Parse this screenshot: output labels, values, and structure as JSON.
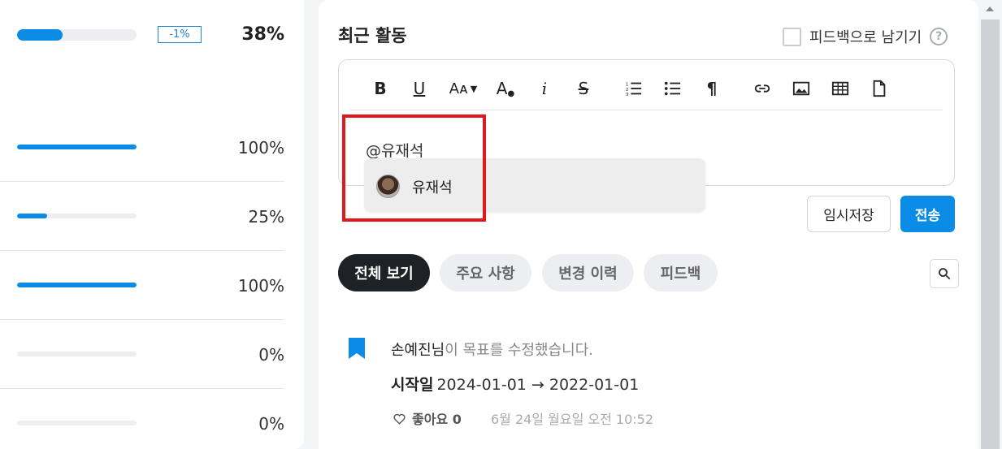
{
  "progress_list": [
    {
      "percent_text": "38%",
      "value": 0.38,
      "delta": "-1%"
    },
    {
      "percent_text": "100%",
      "value": 1.0
    },
    {
      "percent_text": "25%",
      "value": 0.25
    },
    {
      "percent_text": "100%",
      "value": 1.0
    },
    {
      "percent_text": "0%",
      "value": 0.0
    },
    {
      "percent_text": "0%",
      "value": 0.0
    }
  ],
  "activity": {
    "title": "최근 활동",
    "feedback_checkbox_label": "피드백으로 남기기",
    "help_label": "?"
  },
  "editor": {
    "toolbar": [
      {
        "label": "B",
        "icon": "bold-icon"
      },
      {
        "label": "U",
        "icon": "underline-icon"
      },
      {
        "label": "Aᴀ",
        "icon": "font-size-icon"
      },
      {
        "label": "A",
        "icon": "text-color-icon"
      },
      {
        "label": "i",
        "icon": "italic-icon"
      },
      {
        "label": "S",
        "icon": "strikethrough-icon"
      },
      {
        "label": "",
        "icon": "ordered-list-icon"
      },
      {
        "label": "",
        "icon": "bullet-list-icon"
      },
      {
        "label": "¶",
        "icon": "paragraph-icon"
      },
      {
        "label": "",
        "icon": "link-icon"
      },
      {
        "label": "",
        "icon": "image-icon"
      },
      {
        "label": "",
        "icon": "table-icon"
      },
      {
        "label": "",
        "icon": "file-icon"
      }
    ],
    "content_prefix": "@",
    "content_mention": "유재석",
    "mention_suggestion": "유재석"
  },
  "buttons": {
    "save_draft": "임시저장",
    "send": "전송"
  },
  "filters": [
    "전체 보기",
    "주요 사항",
    "변경 이력",
    "피드백"
  ],
  "active_filter": "전체 보기",
  "feed": [
    {
      "author": "손예진님",
      "action": "이 목표를 수정했습니다.",
      "field_label": "시작일",
      "field_change": "2024-01-01 → 2022-01-01",
      "like_label": "좋아요 0",
      "timestamp": "6월 24일 월요일 오전 10:52"
    }
  ],
  "colors": {
    "accent": "#0a8be6",
    "highlight": "#e0191e",
    "active_tab": "#1e2227"
  }
}
